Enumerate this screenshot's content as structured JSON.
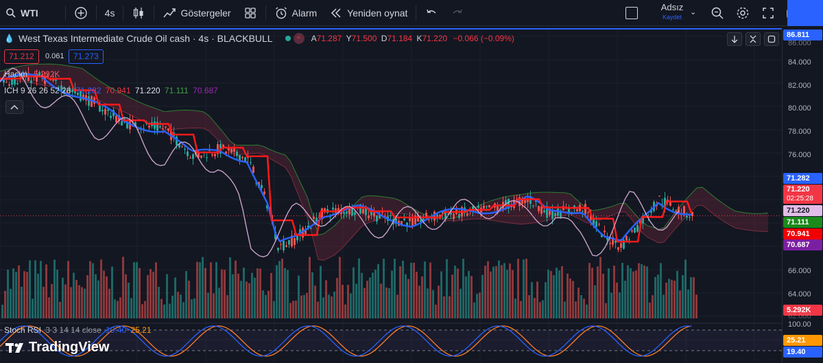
{
  "topbar": {
    "symbol": "WTI",
    "interval": "4s",
    "indicators_label": "Göstergeler",
    "alarm_label": "Alarm",
    "replay_label": "Yeniden oynat",
    "user_name": "Adsız",
    "user_sub": "Kaydet"
  },
  "legend": {
    "title": "West Texas Intermediate Crude Oil cash · 4s · BLACKBULL",
    "ohlc": {
      "o_key": "A",
      "o_val": "71.287",
      "h_key": "Y",
      "h_val": "71.500",
      "l_key": "D",
      "l_val": "71.184",
      "c_key": "K",
      "c_val": "71.220",
      "change": "−0.066 (−0.09%)"
    },
    "sell_price": "71.212",
    "spread": "0.061",
    "buy_price": "71.273",
    "volume_label": "Hacim",
    "volume_value": "5.292K",
    "ich_label": "ICH 9 26 26 52 26",
    "ich_values": [
      "71.282",
      "70.941",
      "71.220",
      "71.111",
      "70.687"
    ]
  },
  "stoch": {
    "label": "Stoch RSI",
    "params": "3 3 14 14 close",
    "k_value": "19.40",
    "d_value": "25.21"
  },
  "price_axis": {
    "ticks": [
      "84.000",
      "82.000",
      "80.000",
      "78.000",
      "76.000",
      "66.000",
      "64.000"
    ],
    "partial_ticks": [
      "86.000",
      "62.000"
    ],
    "top_tag": "86.811",
    "ich_tag": "71.282",
    "last_price": "71.220",
    "countdown": "02:25:28",
    "close_tag": "71.220",
    "green_tag": "71.111",
    "red_tag": "70.941",
    "purple_tag": "70.687",
    "volume_tag": "5.292K",
    "stoch_top": "100.00",
    "stoch_d_tag": "25.21",
    "stoch_k_tag": "19.40"
  },
  "brand": "TradingView",
  "colors": {
    "accent": "#2962ff",
    "up": "#26a69a",
    "down": "#ef5350",
    "tenkan": "#2962ff",
    "kijun": "#ff1a1a",
    "chikou": "#c8a2c8",
    "stoch_k": "#2962ff",
    "stoch_d": "#ff7f2a"
  },
  "chart_data": {
    "type": "candlestick",
    "series": [
      {
        "name": "ICH",
        "values": [
          71.282,
          70.941,
          71.22,
          71.111,
          70.687
        ]
      }
    ],
    "ylim_price": [
      67.0,
      86.8
    ],
    "volume_last": "5.292K",
    "stoch_rsi": {
      "k": 19.4,
      "d": 25.21,
      "ylim": [
        0,
        100
      ]
    }
  }
}
